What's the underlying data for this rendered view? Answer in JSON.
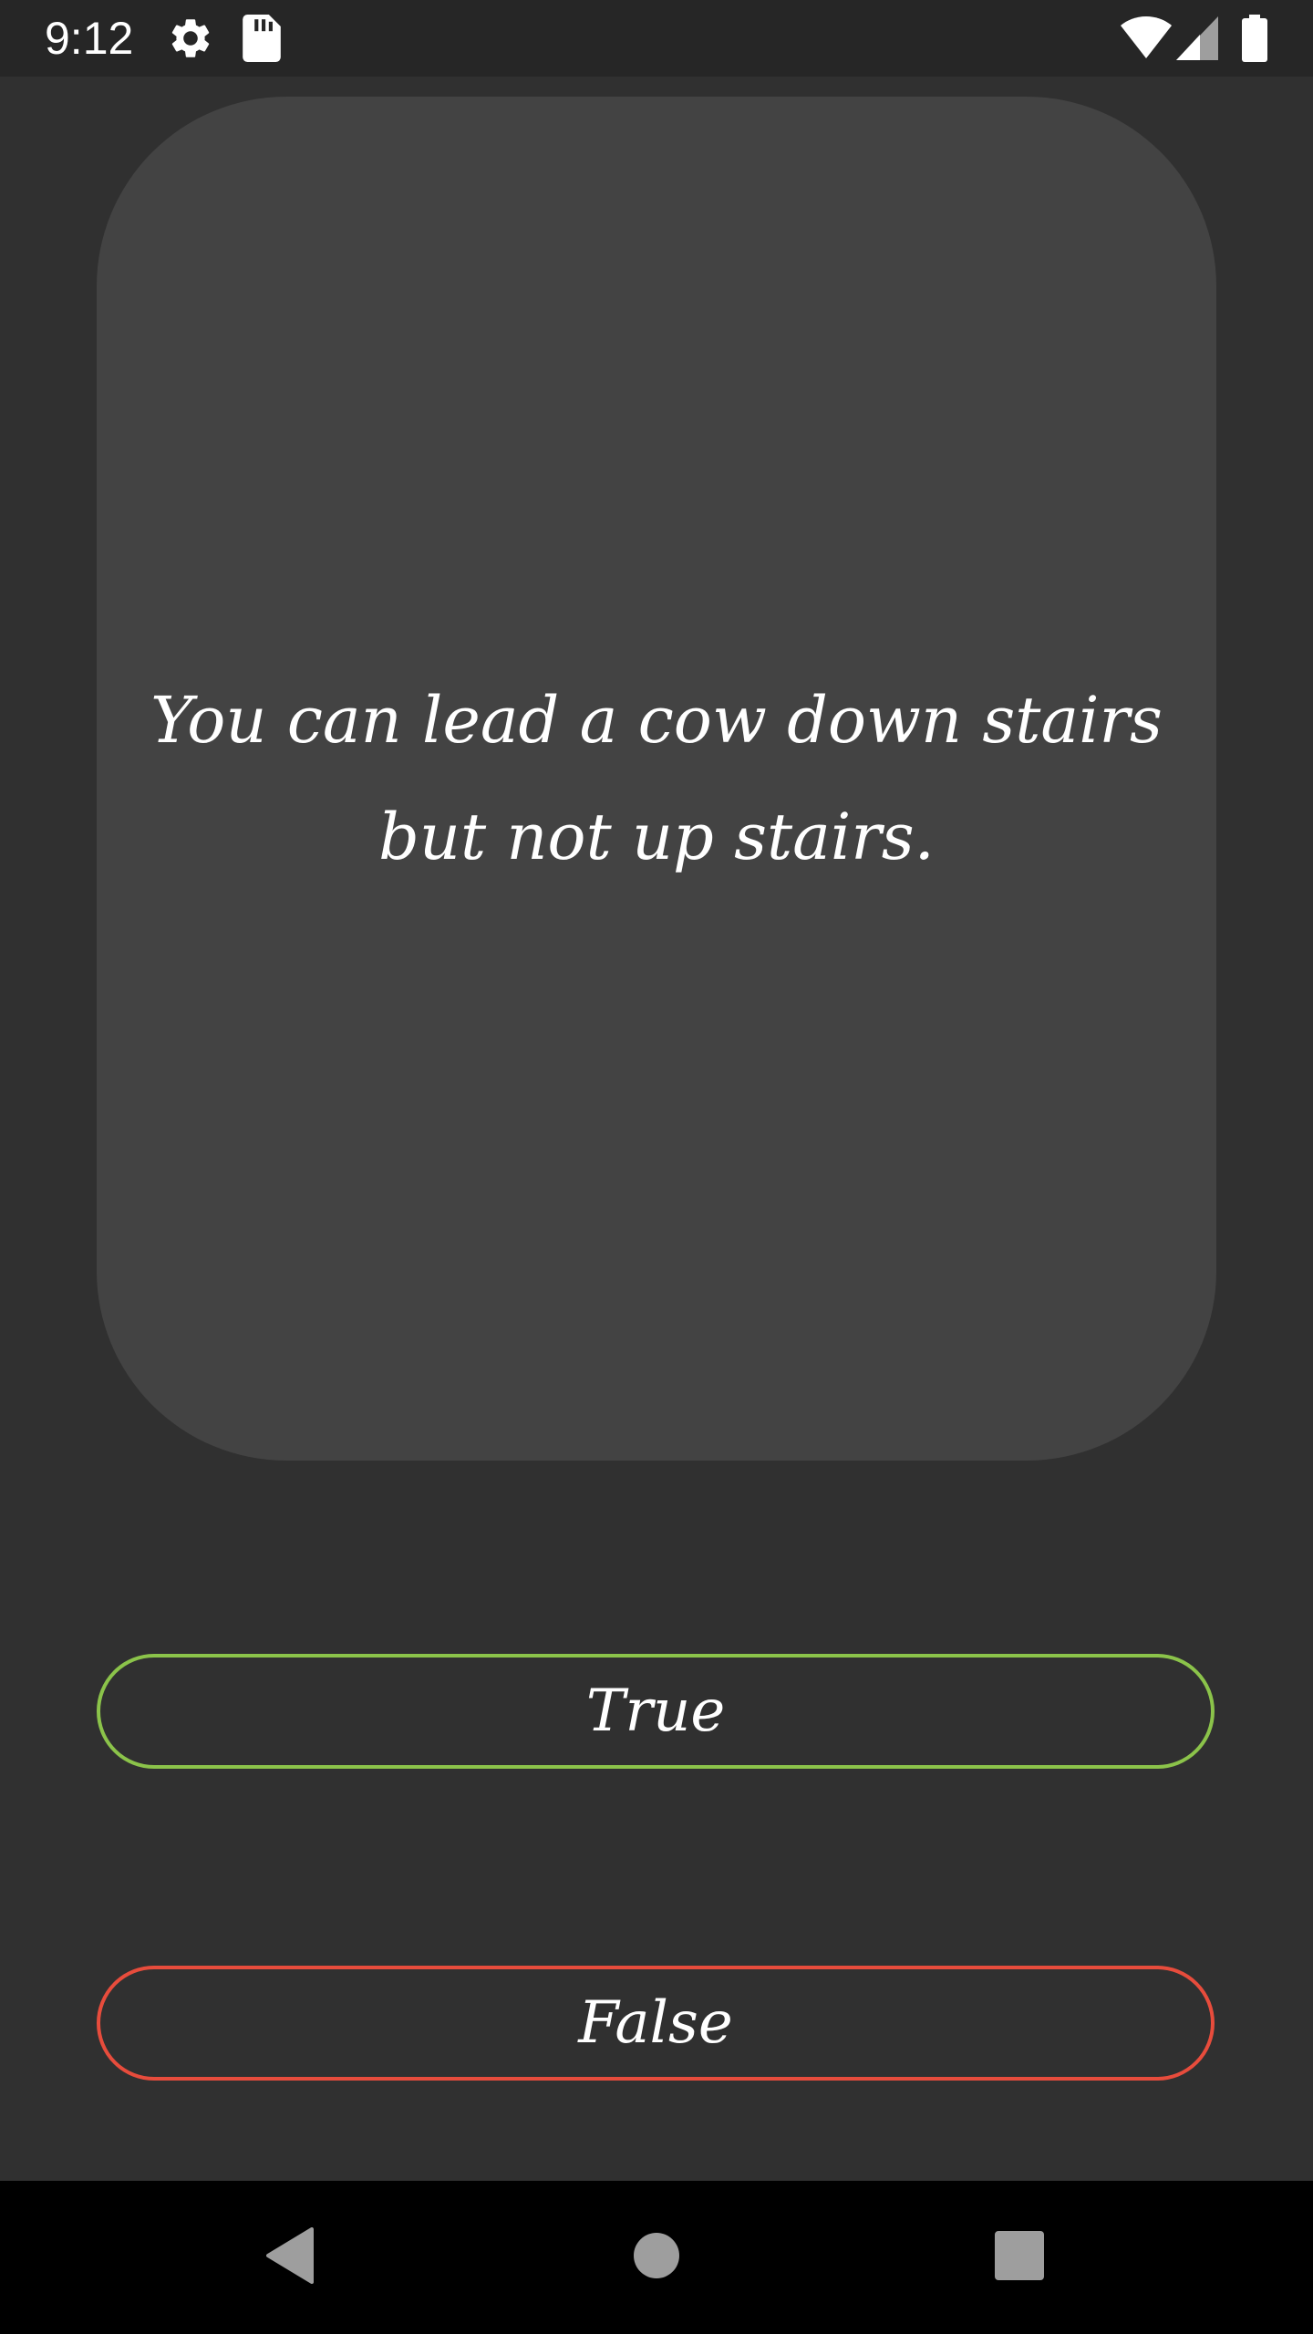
{
  "status_bar": {
    "time": "9:12",
    "icons": [
      "gear-icon",
      "sd-card-icon",
      "wifi-icon",
      "signal-icon",
      "battery-icon"
    ]
  },
  "quiz": {
    "question": "You can lead a cow down stairs but not up stairs.",
    "true_label": "True",
    "false_label": "False"
  },
  "nav_bar": {
    "icons": [
      "back-icon",
      "home-icon",
      "recents-icon"
    ]
  },
  "colors": {
    "background": "#303030",
    "card": "#434343",
    "true_border": "#8bc34a",
    "false_border": "#e74c3c",
    "nav_icon": "#9e9e9e"
  }
}
